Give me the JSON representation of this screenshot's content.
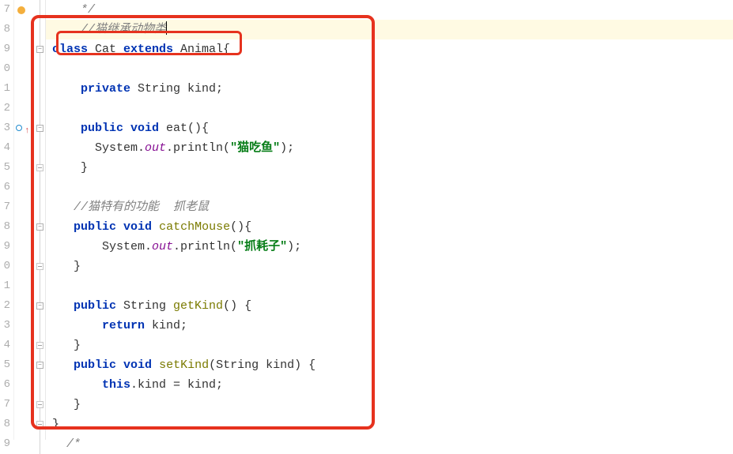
{
  "lineNumbers": [
    "7",
    "8",
    "9",
    "0",
    "1",
    "2",
    "3",
    "4",
    "5",
    "6",
    "7",
    "8",
    "9",
    "0",
    "1",
    "2",
    "3",
    "4",
    "5",
    "6",
    "7",
    "8",
    "9"
  ],
  "code": {
    "l7": {
      "indent": "    ",
      "text": "*/"
    },
    "l8": {
      "indent": "    ",
      "comment": "//猫继承动物类"
    },
    "l9": {
      "kw1": "class",
      "name": " Cat ",
      "kw2": "extends",
      "parent": " Animal{"
    },
    "l10": "",
    "l11": {
      "indent": "    ",
      "kw": "private",
      "rest": " String kind;"
    },
    "l12": "",
    "l13": {
      "indent": "    ",
      "kw": "public void",
      "rest": " eat(){"
    },
    "l14": {
      "indent": "      ",
      "sys": "System.",
      "out": "out",
      "dot": ".println(",
      "str": "\"猫吃鱼\"",
      "end": ");"
    },
    "l15": {
      "indent": "    ",
      "brace": "}"
    },
    "l16": "",
    "l17": {
      "indent": "   ",
      "comment": "//猫特有的功能  抓老鼠"
    },
    "l18": {
      "indent": "   ",
      "kw": "public void",
      "space": " ",
      "method": "catchMouse",
      "rest": "(){"
    },
    "l19": {
      "indent": "       ",
      "sys": "System.",
      "out": "out",
      "dot": ".println(",
      "str": "\"抓耗子\"",
      "end": ");"
    },
    "l20": {
      "indent": "   ",
      "brace": "}"
    },
    "l21": "",
    "l22": {
      "indent": "   ",
      "kw": "public",
      "type": " String ",
      "method": "getKind",
      "rest": "() {"
    },
    "l23": {
      "indent": "       ",
      "kw": "return",
      "rest": " kind;"
    },
    "l24": {
      "indent": "   ",
      "brace": "}"
    },
    "l25": {
      "indent": "   ",
      "kw": "public void",
      "space": " ",
      "method": "setKind",
      "rest": "(String kind) {"
    },
    "l26": {
      "indent": "       ",
      "kw": "this",
      "rest": ".kind = kind;"
    },
    "l27": {
      "indent": "   ",
      "brace": "}"
    },
    "l28": {
      "brace": "}"
    },
    "l29": {
      "indent": "  ",
      "comment": "/*"
    }
  }
}
